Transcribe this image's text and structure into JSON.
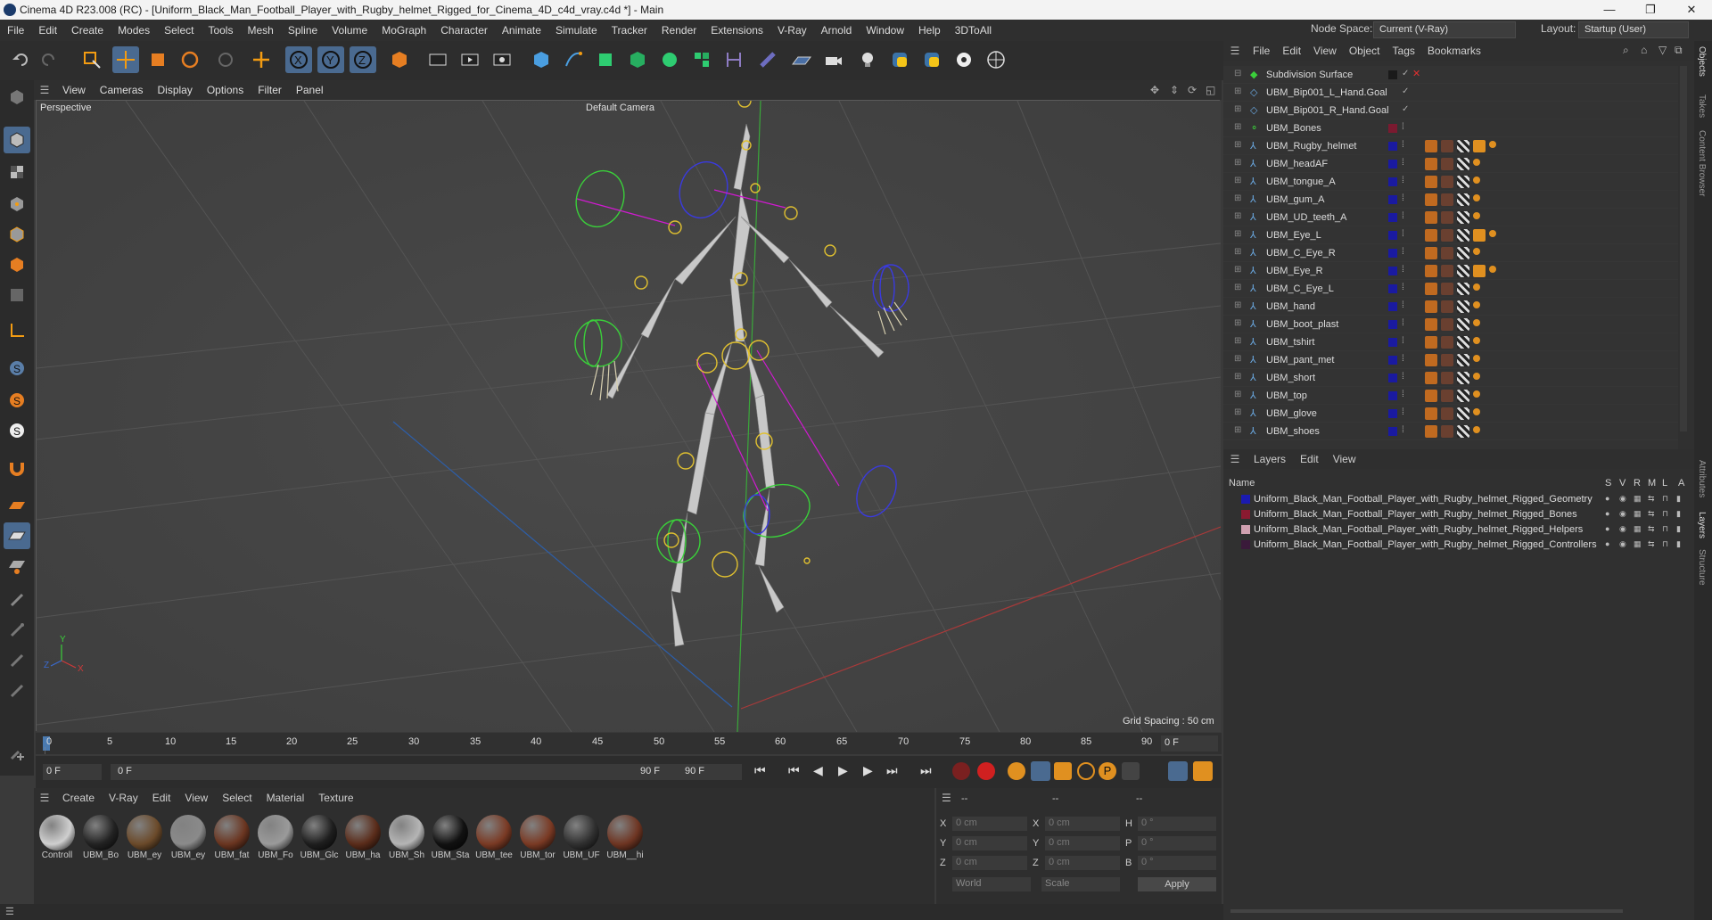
{
  "window": {
    "title": "Cinema 4D R23.008 (RC) - [Uniform_Black_Man_Football_Player_with_Rugby_helmet_Rigged_for_Cinema_4D_c4d_vray.c4d *] - Main",
    "minimize": "—",
    "maximize": "❐",
    "close": "✕"
  },
  "menu": [
    "File",
    "Edit",
    "Create",
    "Modes",
    "Select",
    "Tools",
    "Mesh",
    "Spline",
    "Volume",
    "MoGraph",
    "Character",
    "Animate",
    "Simulate",
    "Tracker",
    "Render",
    "Extensions",
    "V-Ray",
    "Arnold",
    "Window",
    "Help",
    "3DToAll"
  ],
  "node_space": {
    "label": "Node Space:",
    "value": "Current (V-Ray)"
  },
  "layout": {
    "label": "Layout:",
    "value": "Startup (User)"
  },
  "viewport": {
    "menu": [
      "View",
      "Cameras",
      "Display",
      "Options",
      "Filter",
      "Panel"
    ],
    "perspective_label": "Perspective",
    "camera_label": "Default Camera",
    "grid_spacing": "Grid Spacing : 50 cm"
  },
  "timeline": {
    "ticks": [
      "0",
      "5",
      "10",
      "15",
      "20",
      "25",
      "30",
      "35",
      "40",
      "45",
      "50",
      "55",
      "60",
      "65",
      "70",
      "75",
      "80",
      "85",
      "90"
    ],
    "current_frame": "0 F"
  },
  "playbar": {
    "start": "0 F",
    "current": "0 F",
    "end_a": "90 F",
    "end_b": "90 F"
  },
  "materials": {
    "menu": [
      "Create",
      "V-Ray",
      "Edit",
      "View",
      "Select",
      "Material",
      "Texture"
    ],
    "items": [
      {
        "label": "Controll",
        "color": "#cfcfcf"
      },
      {
        "label": "UBM_Bo",
        "color": "#222222"
      },
      {
        "label": "UBM_ey",
        "color": "#6b4a2a"
      },
      {
        "label": "UBM_ey",
        "color": "#8a8a8a"
      },
      {
        "label": "UBM_fat",
        "color": "#6a3520"
      },
      {
        "label": "UBM_Fo",
        "color": "#9a9a9a"
      },
      {
        "label": "UBM_Glc",
        "color": "#1e1e1e"
      },
      {
        "label": "UBM_ha",
        "color": "#5a2c1a"
      },
      {
        "label": "UBM_Sh",
        "color": "#b5b5b5"
      },
      {
        "label": "UBM_Sta",
        "color": "#111111"
      },
      {
        "label": "UBM_tee",
        "color": "#7a3a24"
      },
      {
        "label": "UBM_tor",
        "color": "#7a3a24"
      },
      {
        "label": "UBM_UF",
        "color": "#303030"
      },
      {
        "label": "UBM__hi",
        "color": "#6e3522"
      }
    ]
  },
  "coords": {
    "headers": [
      "--",
      "--",
      "--"
    ],
    "rows": [
      {
        "a": "X",
        "av": "0 cm",
        "b": "X",
        "bv": "0 cm",
        "c": "H",
        "cv": "0 °"
      },
      {
        "a": "Y",
        "av": "0 cm",
        "b": "Y",
        "bv": "0 cm",
        "c": "P",
        "cv": "0 °"
      },
      {
        "a": "Z",
        "av": "0 cm",
        "b": "Z",
        "bv": "0 cm",
        "c": "B",
        "cv": "0 °"
      }
    ],
    "world": "World",
    "scale": "Scale",
    "apply": "Apply"
  },
  "objects": {
    "menu": [
      "File",
      "Edit",
      "View",
      "Object",
      "Tags",
      "Bookmarks"
    ],
    "rows": [
      {
        "name": "Subdivision Surface",
        "color": "#1a1a1a"
      },
      {
        "name": "UBM_Bip001_L_Hand.Goal",
        "color": ""
      },
      {
        "name": "UBM_Bip001_R_Hand.Goal",
        "color": ""
      },
      {
        "name": "UBM_Bones",
        "color": "#7a1a30"
      },
      {
        "name": "UBM_Rugby_helmet",
        "color": "#1a1aa0"
      },
      {
        "name": "UBM_headAF",
        "color": "#1a1aa0"
      },
      {
        "name": "UBM_tongue_A",
        "color": "#1a1aa0"
      },
      {
        "name": "UBM_gum_A",
        "color": "#1a1aa0"
      },
      {
        "name": "UBM_UD_teeth_A",
        "color": "#1a1aa0"
      },
      {
        "name": "UBM_Eye_L",
        "color": "#1a1aa0"
      },
      {
        "name": "UBM_C_Eye_R",
        "color": "#1a1aa0"
      },
      {
        "name": "UBM_Eye_R",
        "color": "#1a1aa0"
      },
      {
        "name": "UBM_C_Eye_L",
        "color": "#1a1aa0"
      },
      {
        "name": "UBM_hand",
        "color": "#1a1aa0"
      },
      {
        "name": "UBM_boot_plast",
        "color": "#1a1aa0"
      },
      {
        "name": "UBM_tshirt",
        "color": "#1a1aa0"
      },
      {
        "name": "UBM_pant_met",
        "color": "#1a1aa0"
      },
      {
        "name": "UBM_short",
        "color": "#1a1aa0"
      },
      {
        "name": "UBM_top",
        "color": "#1a1aa0"
      },
      {
        "name": "UBM_glove",
        "color": "#1a1aa0"
      },
      {
        "name": "UBM_shoes",
        "color": "#1a1aa0"
      }
    ]
  },
  "layers": {
    "menu": [
      "Layers",
      "Edit",
      "View"
    ],
    "columns": {
      "name": "Name",
      "s": "S",
      "v": "V",
      "r": "R",
      "m": "M",
      "l": "L",
      "a": "A"
    },
    "rows": [
      {
        "name": "Uniform_Black_Man_Football_Player_with_Rugby_helmet_Rigged_Geometry",
        "color": "#1a1ab0"
      },
      {
        "name": "Uniform_Black_Man_Football_Player_with_Rugby_helmet_Rigged_Bones",
        "color": "#8a1a30"
      },
      {
        "name": "Uniform_Black_Man_Football_Player_with_Rugby_helmet_Rigged_Helpers",
        "color": "#d0a0b0"
      },
      {
        "name": "Uniform_Black_Man_Football_Player_with_Rugby_helmet_Rigged_Controllers",
        "color": "#3a1a3a"
      }
    ]
  },
  "side_tabs": [
    "Objects",
    "Takes",
    "Content Browser",
    "Attributes",
    "Layers",
    "Structure"
  ]
}
